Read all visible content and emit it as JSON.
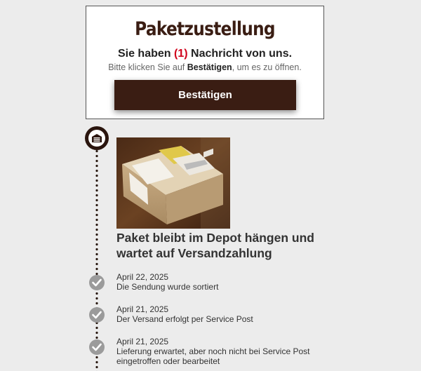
{
  "notice": {
    "title": "Paketzustellung",
    "message_prefix": "Sie haben ",
    "message_count": "(1)",
    "message_suffix": " Nachricht von uns.",
    "hint_prefix": "Bitte klicken Sie auf ",
    "hint_bold": "Bestätigen",
    "hint_suffix": ", um es zu öffnen.",
    "confirm_label": "Bestätigen"
  },
  "timeline": {
    "badge_icon": "garage-door-icon",
    "status_heading": "Paket bleibt im Depot hängen und wartet auf Versandzahlung",
    "check_icon": "checkmark-icon",
    "events": [
      {
        "date": "April 22, 2025",
        "text": "Die Sendung wurde sortiert"
      },
      {
        "date": "April 21, 2025",
        "text": "Der Versand erfolgt per Service Post"
      },
      {
        "date": "April 21, 2025",
        "text": "Lieferung erwartet, aber noch nicht bei Service Post eingetroffen oder bearbeitet"
      }
    ]
  },
  "colors": {
    "brand_brown": "#3a1d13",
    "count_red": "#d0021b",
    "check_grey": "#9b9b9b",
    "background": "#ececec"
  }
}
